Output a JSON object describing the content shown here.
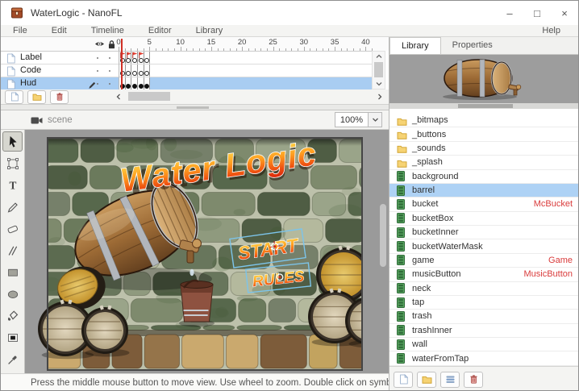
{
  "window": {
    "title": "WaterLogic - NanoFL",
    "controls": {
      "minimize": "–",
      "maximize": "□",
      "close": "×"
    }
  },
  "menu": {
    "items": [
      "File",
      "Edit",
      "Timeline",
      "Editor",
      "Library"
    ],
    "help": "Help"
  },
  "timeline": {
    "ruler_ticks": [
      "0",
      "5",
      "10",
      "15",
      "20",
      "25",
      "30",
      "35",
      "40"
    ],
    "layers": [
      {
        "name": "Label",
        "selected": false,
        "frame_type": "hollow",
        "flag_frames": 4,
        "keyframes": 5
      },
      {
        "name": "Code",
        "selected": false,
        "frame_type": "hollow",
        "flag_frames": 0,
        "keyframes": 5
      },
      {
        "name": "Hud",
        "selected": true,
        "frame_type": "filled",
        "flag_frames": 0,
        "keyframes": 5
      }
    ]
  },
  "tools": {
    "items": [
      "select",
      "free-transform",
      "text",
      "pencil",
      "eraser",
      "line",
      "rectangle",
      "ellipse",
      "paint-bucket",
      "transform-fill",
      "eyedropper"
    ],
    "selected": "select"
  },
  "canvas": {
    "breadcrumb": "scene",
    "zoom": "100%",
    "stage": {
      "title": "Water Logic",
      "start_label": "START",
      "rules_label": "RULES"
    }
  },
  "status_bar": {
    "text": "Press the middle mouse button to move view. Use wheel to zoom. Double click on symbol to edit...."
  },
  "library_panel": {
    "tabs": [
      "Library",
      "Properties"
    ],
    "active_tab": "Library",
    "items": [
      {
        "name": "_bitmaps",
        "type": "folder",
        "selected": false,
        "linkage": ""
      },
      {
        "name": "_buttons",
        "type": "folder",
        "selected": false,
        "linkage": ""
      },
      {
        "name": "_sounds",
        "type": "folder",
        "selected": false,
        "linkage": ""
      },
      {
        "name": "_splash",
        "type": "folder",
        "selected": false,
        "linkage": ""
      },
      {
        "name": "background",
        "type": "symbol",
        "selected": false,
        "linkage": ""
      },
      {
        "name": "barrel",
        "type": "symbol",
        "selected": true,
        "linkage": ""
      },
      {
        "name": "bucket",
        "type": "symbol",
        "selected": false,
        "linkage": "McBucket"
      },
      {
        "name": "bucketBox",
        "type": "symbol",
        "selected": false,
        "linkage": ""
      },
      {
        "name": "bucketInner",
        "type": "symbol",
        "selected": false,
        "linkage": ""
      },
      {
        "name": "bucketWaterMask",
        "type": "symbol",
        "selected": false,
        "linkage": ""
      },
      {
        "name": "game",
        "type": "symbol",
        "selected": false,
        "linkage": "Game"
      },
      {
        "name": "musicButton",
        "type": "symbol",
        "selected": false,
        "linkage": "MusicButton"
      },
      {
        "name": "neck",
        "type": "symbol",
        "selected": false,
        "linkage": ""
      },
      {
        "name": "tap",
        "type": "symbol",
        "selected": false,
        "linkage": ""
      },
      {
        "name": "trash",
        "type": "symbol",
        "selected": false,
        "linkage": ""
      },
      {
        "name": "trashInner",
        "type": "symbol",
        "selected": false,
        "linkage": ""
      },
      {
        "name": "wall",
        "type": "symbol",
        "selected": false,
        "linkage": ""
      },
      {
        "name": "waterFromTap",
        "type": "symbol",
        "selected": false,
        "linkage": ""
      }
    ]
  },
  "colors": {
    "selection": "#aed2f5",
    "linkage_red": "#d93b3b",
    "flag_red": "#e23b2e",
    "playhead_red": "#d03026",
    "stage_mortar": "#bdc1ab",
    "pasteboard": "#9a9a9a"
  }
}
